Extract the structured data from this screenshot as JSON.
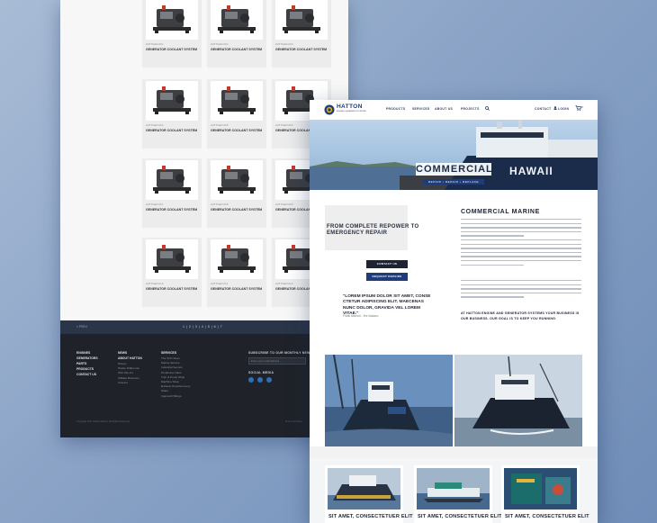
{
  "back_page": {
    "products": [
      {
        "sku": "HATTGEN-001",
        "title": "GENERATOR COOLANT SYSTEM"
      },
      {
        "sku": "HATTGEN-002",
        "title": "GENERATOR COOLANT SYSTEM"
      },
      {
        "sku": "HATTGEN-003",
        "title": "GENERATOR COOLANT SYSTEM"
      },
      {
        "sku": "HATTGEN-004",
        "title": "GENERATOR COOLANT SYSTEM"
      },
      {
        "sku": "HATTGEN-005",
        "title": "GENERATOR COOLANT SYSTEM"
      },
      {
        "sku": "HATTGEN-006",
        "title": "GENERATOR COOLANT SYSTEM"
      },
      {
        "sku": "HATTGEN-007",
        "title": "GENERATOR COOLANT SYSTEM"
      },
      {
        "sku": "HATTGEN-008",
        "title": "GENERATOR COOLANT SYSTEM"
      },
      {
        "sku": "HATTGEN-009",
        "title": "GENERATOR COOLANT SYSTEM"
      },
      {
        "sku": "HATTGEN-010",
        "title": "GENERATOR COOLANT SYSTEM"
      },
      {
        "sku": "HATTGEN-011",
        "title": "GENERATOR COOLANT SYSTEM"
      },
      {
        "sku": "HATTGEN-012",
        "title": "GENERATOR COOLANT SYSTEM"
      }
    ],
    "pagination_prev": "« PREV",
    "pagination_pages": "1 | 2 | 3 | 4 | 5 | 6 | 7",
    "footer": {
      "col1": [
        "ENGINES",
        "GENERATORS",
        "PARTS",
        "PRODUCTS",
        "CONTACT US"
      ],
      "col2_title": "NEWS",
      "col2_sub": "ABOUT HATTON",
      "col2": [
        "History",
        "Hatton Difference",
        "Who We Are",
        "Affiliate Business",
        "Careers"
      ],
      "col3_title": "SERVICES",
      "col3": [
        "The SCC Fleet",
        "Marine Service",
        "Industrial Service",
        "Production Sites",
        "Turn & Pump Shop",
        "Machine Shop",
        "Exhaust Heat Recovery",
        "Sales",
        "Ingersoll Hillings"
      ],
      "newsletter_title": "SUBSCRIBE TO OUR MONTHLY NEWSLETTER",
      "newsletter_placeholder": "Enter your email address",
      "social_title": "SOCIAL MEDIA",
      "copyright": "Copyright 2017 Hatton Marine. All Rights Reserved.",
      "terms": "Terms & Privacy"
    }
  },
  "front_page": {
    "logo": {
      "name": "HATTON",
      "tagline": "ENGINE & GENERATOR SYSTEMS"
    },
    "nav": [
      "PRODUCTS",
      "SERVICES",
      "ABOUT US",
      "PROJECTS"
    ],
    "nav_right": [
      "CONTACT",
      "LOGIN"
    ],
    "cart_count": "0",
    "hero": {
      "title": "COMMERCIAL",
      "subtitle": "REPAIR • REPAIR • REPLACE",
      "ship_name": "HAWAII"
    },
    "intro_heading": "FROM COMPLETE REPOWER TO EMERGENCY REPAIR",
    "buttons": {
      "contact": "CONTACT US",
      "request": "REQUEST REPAIRS"
    },
    "testimonial": "\"LOREM IPSUM DOLOR SIT AMET, CONSE CTETUR ADIPISCING ELIT. MAECENAS NUNC DOLOR, GRAVIDA VEL LOREM VITAE.\"",
    "testimonial_by": "Frank Atwood - Jes Vactaco",
    "section_heading": "COMMERCIAL MARINE",
    "bold_note": "AT HATTON ENGINE AND GENERATOR SYSTEMS YOUR BUSINESS IS OUR BUSINESS. OUR GOAL IS TO KEEP YOU RUNNING.",
    "cards": [
      {
        "title": "SIT AMET, CONSECTETUER ELIT"
      },
      {
        "title": "SIT AMET, CONSECTETUER ELIT"
      },
      {
        "title": "SIT AMET, CONSECTETUER ELIT"
      }
    ]
  },
  "colors": {
    "navy": "#1f3c7a",
    "dark": "#1d2333",
    "background": "#8aa3c6"
  },
  "icons": [
    "search-icon",
    "user-icon",
    "cart-icon",
    "facebook-icon",
    "twitter-icon",
    "linkedin-icon"
  ]
}
